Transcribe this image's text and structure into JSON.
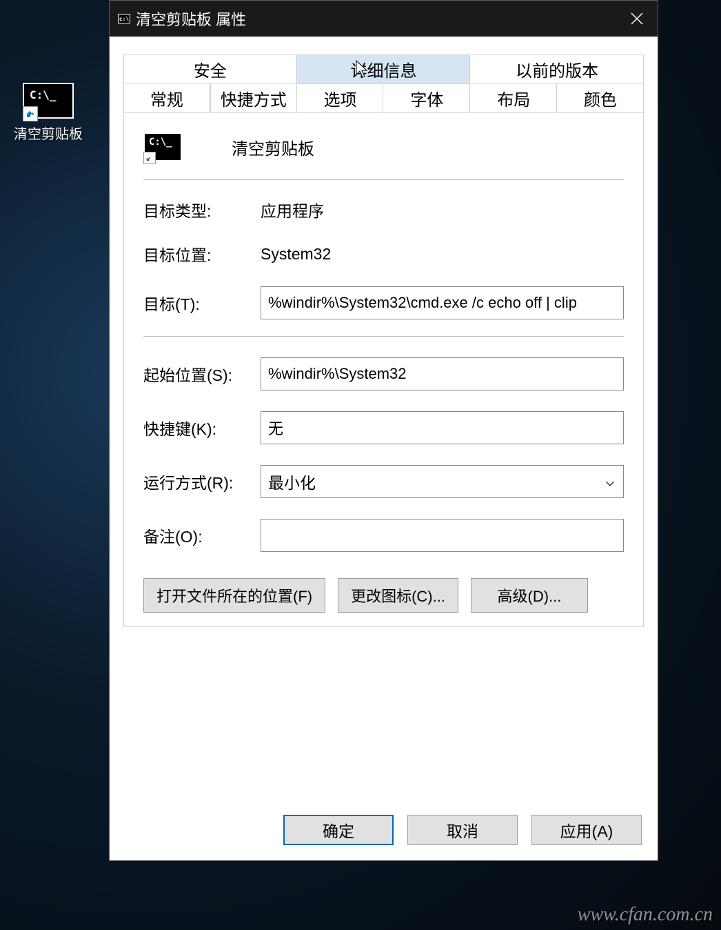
{
  "desktop": {
    "shortcut_label": "清空剪贴板",
    "cmd_prompt_text": "C:\\_"
  },
  "dialog": {
    "title": "清空剪贴板 属性",
    "tabs_top": [
      "安全",
      "详细信息",
      "以前的版本"
    ],
    "tabs_bottom": [
      "常规",
      "快捷方式",
      "选项",
      "字体",
      "布局",
      "颜色"
    ],
    "shortcut_name": "清空剪贴板",
    "labels": {
      "target_type": "目标类型:",
      "target_location": "目标位置:",
      "target": "目标(T):",
      "start_in": "起始位置(S):",
      "shortcut_key": "快捷键(K):",
      "run": "运行方式(R):",
      "comment": "备注(O):"
    },
    "values": {
      "target_type": "应用程序",
      "target_location": "System32",
      "target": "%windir%\\System32\\cmd.exe /c echo off | clip",
      "start_in": "%windir%\\System32",
      "shortcut_key": "无",
      "run": "最小化",
      "comment": ""
    },
    "buttons": {
      "open_location": "打开文件所在的位置(F)",
      "change_icon": "更改图标(C)...",
      "advanced": "高级(D)..."
    },
    "footer": {
      "ok": "确定",
      "cancel": "取消",
      "apply": "应用(A)"
    }
  },
  "watermark": "www.cfan.com.cn"
}
